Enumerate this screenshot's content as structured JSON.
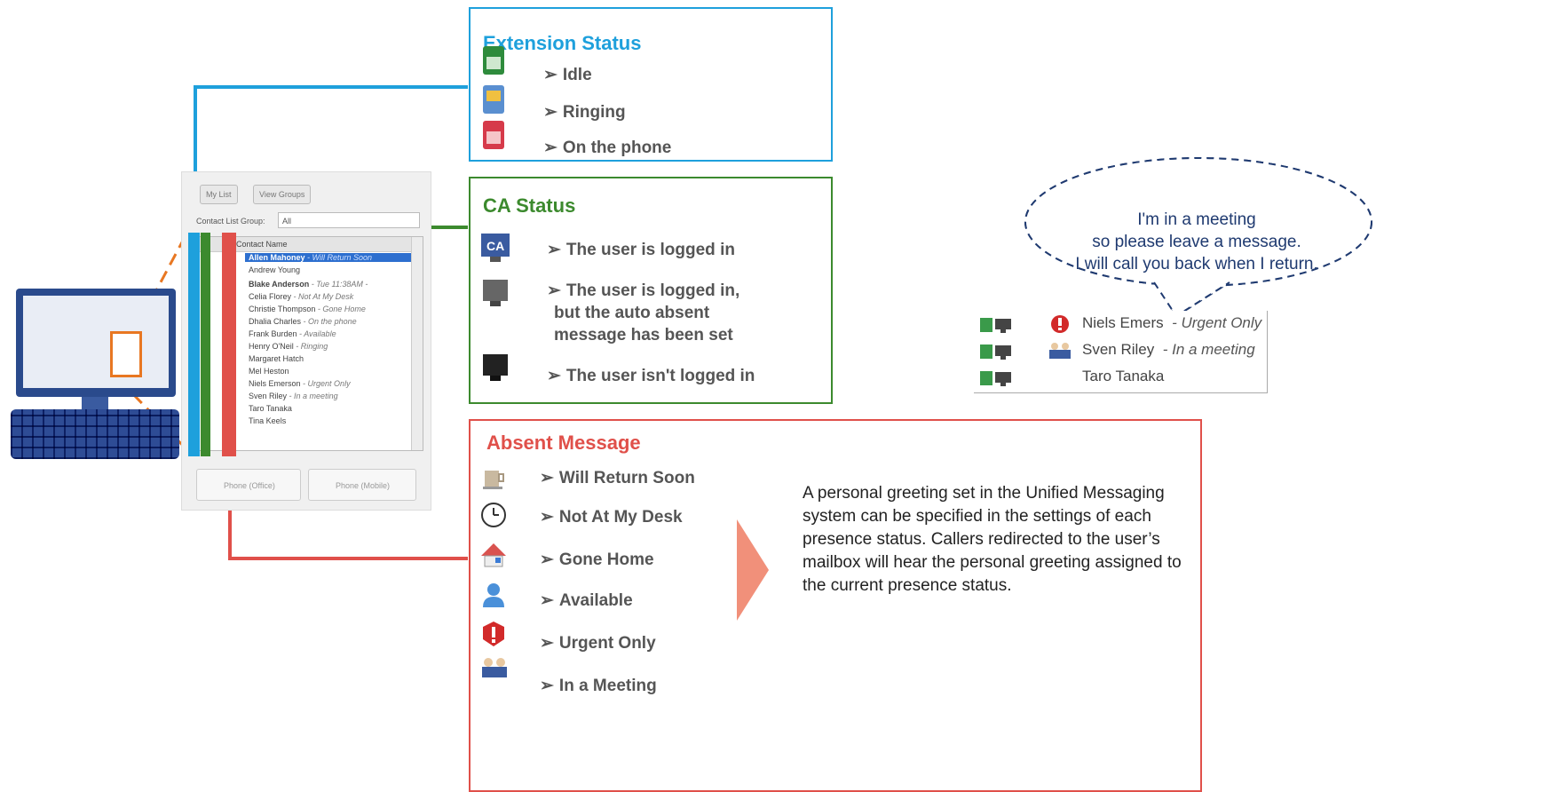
{
  "extension_status": {
    "title": "Extension Status",
    "items": [
      "Idle",
      "Ringing",
      "On the phone"
    ],
    "color": "#1ea0dc"
  },
  "ca_status": {
    "title": "CA Status",
    "items": [
      "The user is logged in",
      "The user is logged in,\nbut the auto absent\nmessage has been set",
      "The user isn't logged in"
    ],
    "color": "#3c8a2e"
  },
  "absent_message": {
    "title": "Absent Message",
    "items": [
      "Will Return Soon",
      "Not At My Desk",
      "Gone Home",
      "Available",
      "Urgent Only",
      "In a Meeting"
    ],
    "color": "#e0504a"
  },
  "description": "A personal greeting set in the Unified Messaging system can be specified in the settings of each presence status. Callers redirected to the user’s mailbox will hear the personal greeting assigned to the current presence status.",
  "bubble": {
    "line1": "I'm in a meeting",
    "line2": "so please leave a message.",
    "line3": "I will call you back when I return."
  },
  "presence_panel": {
    "rows": [
      {
        "name": "Niels Emers",
        "status": "- Urgent Only"
      },
      {
        "name": "Sven Riley",
        "status": "- In a meeting"
      },
      {
        "name": "Taro Tanaka",
        "status": ""
      }
    ]
  },
  "contact_window": {
    "tab1": "My List",
    "tab2": "View Groups",
    "group_label": "Contact List Group:",
    "group_value": "All",
    "column_header": "Contact Name",
    "rows": [
      {
        "name": "Allen Mahoney",
        "status": "- Will Return Soon"
      },
      {
        "name": "Andrew Young",
        "status": ""
      },
      {
        "name": "Blake Anderson",
        "status": "- Tue 11:38AM -"
      },
      {
        "name": "Celia Florey",
        "status": "- Not At My Desk"
      },
      {
        "name": "Christie Thompson",
        "status": "- Gone Home"
      },
      {
        "name": "Dhalia Charles",
        "status": "- On the phone"
      },
      {
        "name": "Frank Burden",
        "status": "- Available"
      },
      {
        "name": "Henry O'Neil",
        "status": "- Ringing"
      },
      {
        "name": "Margaret Hatch",
        "status": ""
      },
      {
        "name": "Mel Heston",
        "status": ""
      },
      {
        "name": "Niels Emerson",
        "status": "- Urgent Only"
      },
      {
        "name": "Sven Riley",
        "status": "- In a meeting"
      },
      {
        "name": "Taro Tanaka",
        "status": ""
      },
      {
        "name": "Tina Keels",
        "status": ""
      }
    ],
    "phone_office": "Phone (Office)",
    "phone_mobile": "Phone (Mobile)"
  }
}
